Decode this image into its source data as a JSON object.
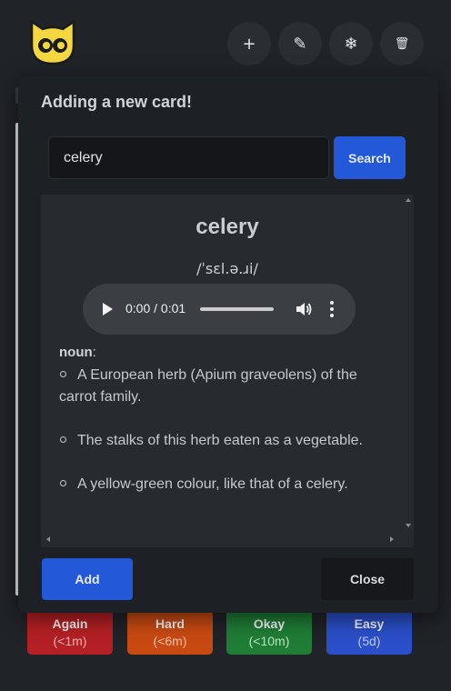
{
  "toolbar": {
    "add_label": "+",
    "edit_label": "✎",
    "freeze_label": "❄",
    "delete_label": "🗑"
  },
  "grades": [
    {
      "label": "Again",
      "interval": "(<1m)",
      "color": "#b42024",
      "text_color": "#f3b4b4"
    },
    {
      "label": "Hard",
      "interval": "(<6m)",
      "color": "#c84a12",
      "text_color": "#f7c3a4"
    },
    {
      "label": "Okay",
      "interval": "(<10m)",
      "color": "#1f7d35",
      "text_color": "#b5e6c0"
    },
    {
      "label": "Easy",
      "interval": "(5d)",
      "color": "#2a4fc8",
      "text_color": "#bcc9f5"
    }
  ],
  "modal": {
    "title": "Adding a new card!",
    "search_value": "celery",
    "search_button": "Search",
    "add_button": "Add",
    "close_button": "Close"
  },
  "entry": {
    "word": "celery",
    "ipa": "/ˈsɛl.ə.ɹi/",
    "audio_time": "0:00 / 0:01",
    "part_of_speech": "noun",
    "definitions": [
      "A European herb (Apium graveolens) of the carrot family.",
      "The stalks of this herb eaten as a vegetable.",
      "A yellow-green colour, like that of a celery."
    ]
  },
  "colors": {
    "accent": "#2358d8",
    "background": "#202328",
    "modal": "#1d2024"
  }
}
